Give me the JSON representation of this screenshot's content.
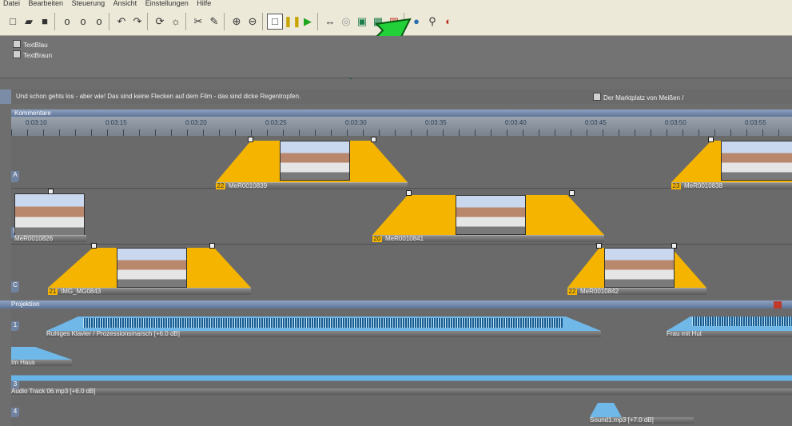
{
  "menu": [
    "Datei",
    "Bearbeiten",
    "Steuerung",
    "Ansicht",
    "Einstellungen",
    "Hilfe"
  ],
  "toolbar_icons": [
    "new-icon",
    "open-icon",
    "save-icon",
    "lock-icon",
    "lock-plus-icon",
    "lock-minus-icon",
    "undo-icon",
    "redo-icon",
    "refresh-icon",
    "cycle-icon",
    "cut-icon",
    "pen-icon",
    "zoom-in-icon",
    "zoom-out-icon",
    "stop-icon",
    "pause-icon",
    "play-icon",
    "loop-icon",
    "record-icon",
    "window-icon",
    "split-icon",
    "grid-icon",
    "group-icon",
    "wand-icon",
    "magnet-icon"
  ],
  "text_items": [
    "TextBlau",
    "TextBraun"
  ],
  "caption_text": "Und schon gehts los - aber wie! Das sind keine Flecken auf dem Film - das sind dicke Regentropfen.",
  "caption_right": "Der Marktplatz von Meißen /",
  "comment_label": "Kommentare",
  "ruler_ticks": [
    "0:03:10",
    "0:03:15",
    "0:03:20",
    "0:03:25",
    "0:03:30",
    "0:03:35",
    "0:03:40",
    "0:03:45",
    "0:03:50",
    "0:03:55"
  ],
  "lanes": [
    "A",
    "B",
    "C"
  ],
  "clips": [
    {
      "num": "22",
      "name": "MeR0010839"
    },
    {
      "num": "23",
      "name": "MeR0010838"
    },
    {
      "num": "",
      "name": "MeR0010826"
    },
    {
      "num": "20",
      "name": "MeR0010841"
    },
    {
      "num": "21",
      "name": "IMG_MG0843"
    },
    {
      "num": "22",
      "name": "MeR0010842"
    }
  ],
  "projection_label": "Projektion",
  "audio_lanes": [
    "1",
    "2",
    "3",
    "4"
  ],
  "audio_clips": [
    {
      "name": "Ruhiges Klavier / Prozessionsmarsch [+6.0 dB]"
    },
    {
      "name": "Frau mit Hut"
    },
    {
      "name": "Im Haus"
    },
    {
      "name": "Audio Track 06.mp3 [+6.0 dB]"
    },
    {
      "name": "Sound1.mp3 [+7.0 dB]"
    }
  ],
  "colors": {
    "clip": "#f4b400",
    "accent": "#5e7497",
    "arrow": "#22d13a"
  }
}
